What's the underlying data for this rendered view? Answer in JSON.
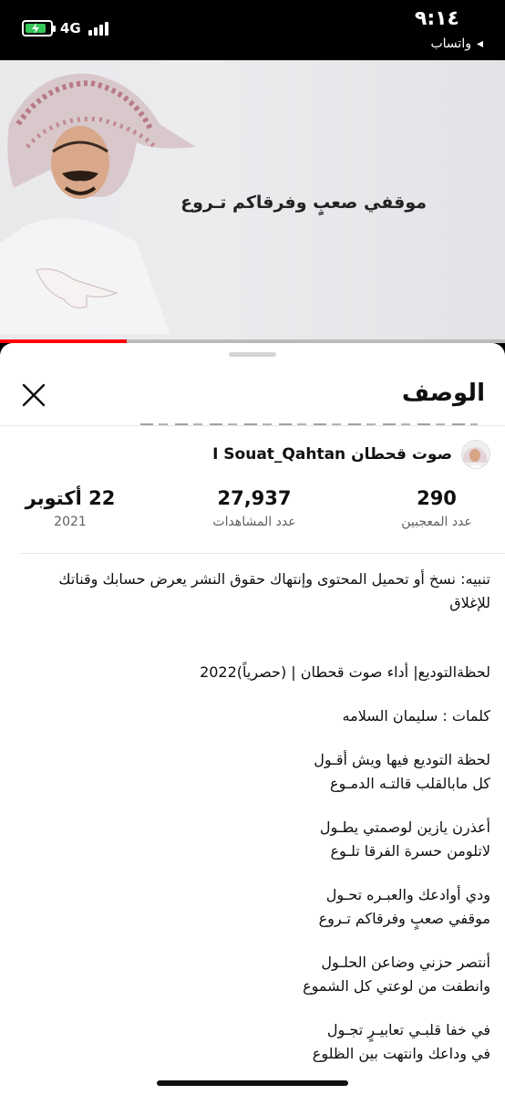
{
  "status_bar": {
    "time": "٩:١٤",
    "back_label": "واتساب",
    "network": "4G",
    "battery_level": 0.85,
    "battery_color": "#34c759"
  },
  "video": {
    "caption": "موقفي صعبٍ وفرقاكم تـروع",
    "progress": 0.25,
    "progress_color": "#ff0000"
  },
  "sheet": {
    "title": "الوصف",
    "close_icon": "close-icon"
  },
  "channel": {
    "name": "صوت قحطان I Souat_Qahtan"
  },
  "stats": [
    {
      "value": "290",
      "label": "عدد المعجبين"
    },
    {
      "value": "27,937",
      "label": "عدد المشاهدات"
    },
    {
      "value": "22 أكتوبر",
      "label": "2021"
    }
  ],
  "description": {
    "warning": "تنبيه: نسخ أو تحميل المحتوى وإنتهاك حقوق النشر يعرض حسابك وقناتك للإغلاق",
    "title_line": "لحظةالتوديع| أداء صوت قحطان | (حصرياً)2022",
    "credits": "كلمات : سليمان السلامه",
    "verses": [
      "لحظة التوديع فيها ويش أقـول\nكل مابالقلب قالتـه الدمـوع",
      "أعذرن يازين لوصمتي يطـول\nلاتلومن حسرة الفرقا تلـوع",
      "ودي أوادعك والعبـره تحـول\nموقفي صعبٍ وفرقاكم تـروع",
      "أنتصر حزني وضاعن الحلـول\nوانطفت من لوعتي كل الشموع",
      "في خفا قلبـي تعابيـرٍ تجـول\nفي وداعك وانتهت بين الظلوع"
    ]
  }
}
